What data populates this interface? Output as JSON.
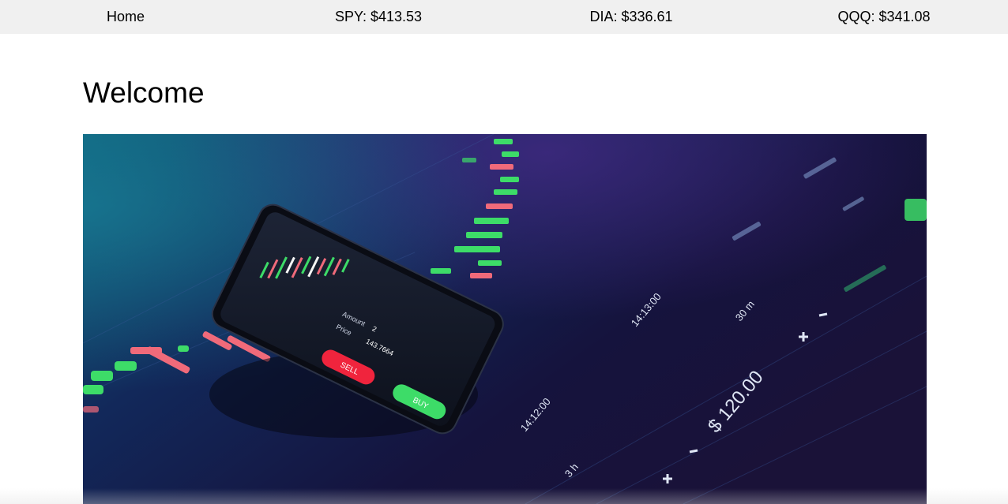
{
  "nav": {
    "home_label": "Home",
    "tickers": [
      {
        "label": "SPY: $413.53"
      },
      {
        "label": "DIA: $336.61"
      },
      {
        "label": "QQQ: $341.08"
      }
    ]
  },
  "main": {
    "title": "Welcome"
  },
  "hero_image": {
    "phone": {
      "amount_label": "Amount",
      "amount_value": "2",
      "price_label": "Price",
      "price_value": "143.7664",
      "sell_label": "SELL",
      "buy_label": "BUY"
    },
    "dashboard": {
      "price_value": "$ 120.00",
      "time_a": "14:13:00",
      "time_b": "14:12:00",
      "interval_a": "30 m",
      "interval_b": "3 h"
    }
  },
  "colors": {
    "navbar_bg": "#f0f0f0",
    "buy_green": "#3ddc68",
    "sell_red": "#f0243d",
    "hero_bg": "#0c1030"
  }
}
